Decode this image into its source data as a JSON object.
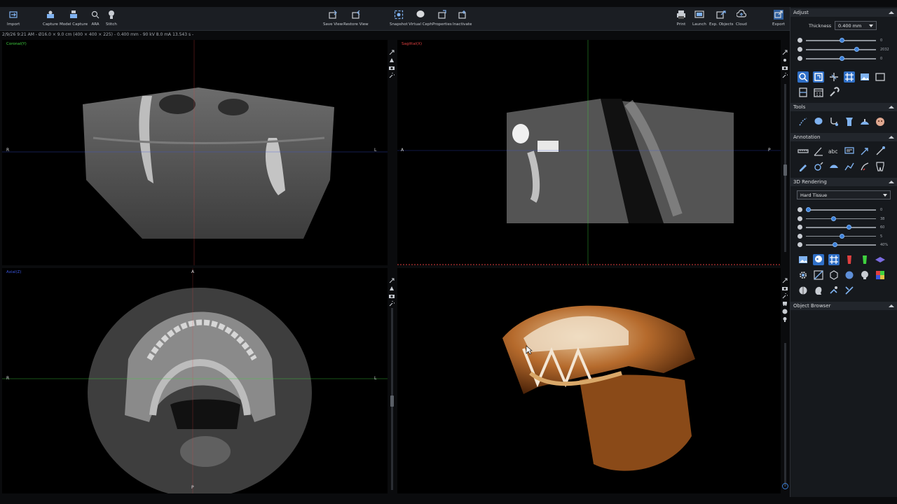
{
  "toolbar": {
    "left": [
      {
        "label": "Import",
        "icon": "import-icon"
      },
      {
        "label": "Capture",
        "icon": "capture-icon"
      },
      {
        "label": "Model Capture",
        "icon": "model-capture-icon"
      },
      {
        "label": "ARA",
        "icon": "ara-icon"
      },
      {
        "label": "Stitch",
        "icon": "stitch-icon"
      }
    ],
    "center": [
      {
        "label": "Save View",
        "icon": "save-view-icon"
      },
      {
        "label": "Restore View",
        "icon": "restore-view-icon"
      },
      {
        "label": "Snapshot",
        "icon": "snapshot-icon"
      },
      {
        "label": "Virtual Ceph",
        "icon": "virtual-ceph-icon"
      },
      {
        "label": "Properties",
        "icon": "properties-icon"
      },
      {
        "label": "Inactivate",
        "icon": "inactivate-icon"
      }
    ],
    "right": [
      {
        "label": "Print",
        "icon": "print-icon"
      },
      {
        "label": "Launch",
        "icon": "launch-icon"
      },
      {
        "label": "Exp. Objects",
        "icon": "export-objects-icon"
      },
      {
        "label": "Cloud",
        "icon": "cloud-icon"
      },
      {
        "label": "Export",
        "icon": "export-icon"
      }
    ]
  },
  "info_bar": "2/9/26 9:21 AM - Ø16.0 × 9.0 cm (400 × 400 × 225) - 0.400 mm - 90 kV 8.0 mA 13.543 s -",
  "viewports": {
    "coronal": {
      "title": "Coronal(Y)",
      "title_color": "#3fd13f",
      "left": "R",
      "right": "L"
    },
    "sagittal": {
      "title": "Sagittal(X)",
      "title_color": "#e04040",
      "left": "A",
      "right": "P"
    },
    "axial": {
      "title": "Axial(Z)",
      "title_color": "#3a56e0",
      "top": "A",
      "left": "R",
      "right": "L",
      "bottom": "P"
    }
  },
  "panel": {
    "adjust": {
      "title": "Adjust",
      "thickness_label": "Thickness",
      "thickness_value": "0.400 mm",
      "sliders": [
        {
          "icon": "contrast-icon",
          "value": "0",
          "level": 0.5
        },
        {
          "icon": "brightness-icon",
          "value": "2032",
          "level": 0.72
        },
        {
          "icon": "gamma-icon",
          "value": "0",
          "level": 0.5
        }
      ],
      "icons_row1": [
        "zoom-icon",
        "reset-view-icon",
        "pan-icon",
        "grid-icon",
        "image-icon",
        "frame-icon"
      ],
      "icons_row2": [
        "layout-icon",
        "calendar-icon",
        "wrench-icon"
      ]
    },
    "tools": {
      "title": "Tools",
      "icons": [
        "nerve-tracing-icon",
        "tooth-icon",
        "curve-icon",
        "implant-icon",
        "airway-icon",
        "face-icon"
      ]
    },
    "annotation": {
      "title": "Annotation",
      "icons_row1": [
        "ruler-icon",
        "angle-icon",
        "text-icon",
        "comment-icon",
        "arrow-icon",
        "line-icon"
      ],
      "icons_row2": [
        "pen-icon",
        "circle-icon",
        "area-icon",
        "polyline-icon",
        "freehand-icon",
        "tooth-chart-icon"
      ]
    },
    "rendering": {
      "title": "3D Rendering",
      "preset": "Hard Tissue",
      "sliders": [
        {
          "icon": "opacity-icon",
          "value": "0",
          "level": 0.0
        },
        {
          "icon": "threshold-icon",
          "value": "38",
          "level": 0.38
        },
        {
          "icon": "contrast-3d-icon",
          "value": "60",
          "level": 0.6
        },
        {
          "icon": "brightness-3d-icon",
          "value": "5",
          "level": 0.5
        },
        {
          "icon": "transparency-icon",
          "value": "40%",
          "level": 0.4
        }
      ],
      "icons_row1": [
        "render-image-icon",
        "skull-icon",
        "grid-3d-icon",
        "clip-icon",
        "green-clip-icon",
        "plane-icon"
      ],
      "icons_row2": [
        "gear-3d-icon",
        "slice-icon",
        "box-icon",
        "sphere-icon",
        "head-icon",
        "color-grid-icon"
      ],
      "icons_row3": [
        "skull-side-icon",
        "head-profile-icon",
        "rotate-icon",
        "cut-icon"
      ]
    },
    "object_browser": {
      "title": "Object Browser"
    }
  },
  "colors": {
    "crosshair_green": "#3fd13f",
    "crosshair_blue": "#3a56e0",
    "crosshair_red": "#e04040",
    "accent_blue": "#3b7fd8",
    "bone_3d": "#b56a2c"
  }
}
